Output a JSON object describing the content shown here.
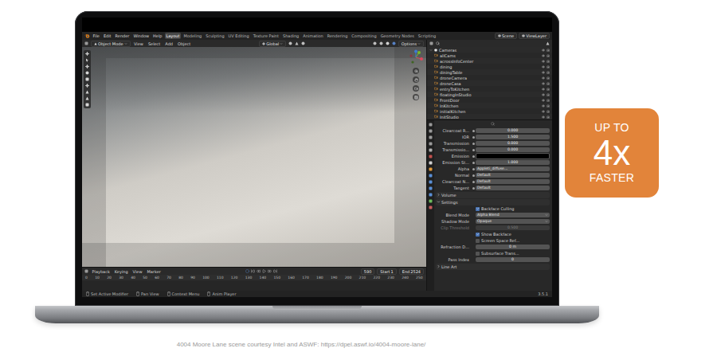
{
  "blender": {
    "menu": [
      "File",
      "Edit",
      "Render",
      "Window",
      "Help"
    ],
    "workspaces": [
      {
        "label": "Layout",
        "selected": true
      },
      {
        "label": "Modeling",
        "selected": false
      },
      {
        "label": "Sculpting",
        "selected": false
      },
      {
        "label": "UV Editing",
        "selected": false
      },
      {
        "label": "Texture Paint",
        "selected": false
      },
      {
        "label": "Shading",
        "selected": false
      },
      {
        "label": "Animation",
        "selected": false
      },
      {
        "label": "Rendering",
        "selected": false
      },
      {
        "label": "Compositing",
        "selected": false
      },
      {
        "label": "Geometry Nodes",
        "selected": false
      },
      {
        "label": "Scripting",
        "selected": false
      }
    ],
    "scene": "Scene",
    "view_layer": "ViewLayer",
    "viewport": {
      "mode": "Object Mode",
      "menus": [
        "View",
        "Select",
        "Add",
        "Object"
      ],
      "orientation": "Global",
      "options": "Options"
    },
    "outliner": {
      "items": [
        {
          "label": "Cameras",
          "kind": "collection",
          "selected": false
        },
        {
          "label": "allCams",
          "kind": "camera",
          "selected": false
        },
        {
          "label": "acrossInfoCenter",
          "kind": "camera",
          "selected": false
        },
        {
          "label": "dining",
          "kind": "camera",
          "selected": false
        },
        {
          "label": "diningTable",
          "kind": "camera",
          "selected": false
        },
        {
          "label": "droneCamera",
          "kind": "camera",
          "selected": false
        },
        {
          "label": "droneCasa",
          "kind": "camera",
          "selected": false
        },
        {
          "label": "entryToKitchen",
          "kind": "camera",
          "selected": false
        },
        {
          "label": "floatingInStudio",
          "kind": "camera",
          "selected": false
        },
        {
          "label": "FrontDoor",
          "kind": "camera",
          "selected": false
        },
        {
          "label": "InKitchen",
          "kind": "camera",
          "selected": false
        },
        {
          "label": "initialKitchen",
          "kind": "camera",
          "selected": false
        },
        {
          "label": "InitStudio",
          "kind": "camera",
          "selected": false
        }
      ]
    },
    "properties": {
      "rows": [
        {
          "kind": "number",
          "label": "Clearcoat R...",
          "value": "0.000"
        },
        {
          "kind": "number",
          "label": "IOR",
          "value": "1.500"
        },
        {
          "kind": "number",
          "label": "Transmission",
          "value": "0.000"
        },
        {
          "kind": "number",
          "label": "Transmissio...",
          "value": "0.000"
        },
        {
          "kind": "color",
          "label": "Emission",
          "color": "#000000"
        },
        {
          "kind": "number",
          "label": "Emission St...",
          "value": "1.000"
        },
        {
          "kind": "link",
          "label": "Alpha",
          "value": "Appleti_diffuse..."
        },
        {
          "kind": "link",
          "label": "Normal",
          "value": "Default"
        },
        {
          "kind": "link",
          "label": "Clearcoat N...",
          "value": "Default"
        },
        {
          "kind": "link",
          "label": "Tangent",
          "value": "Default"
        },
        {
          "kind": "section",
          "label": "Volume",
          "expanded": false
        },
        {
          "kind": "section",
          "label": "Settings",
          "expanded": true
        },
        {
          "kind": "checkbox",
          "label": "Backface Culling",
          "checked": true
        },
        {
          "kind": "dropdown",
          "label": "Blend Mode",
          "value": "Alpha Blend"
        },
        {
          "kind": "dropdown",
          "label": "Shadow Mode",
          "value": "Opaque"
        },
        {
          "kind": "field",
          "label": "Clip Threshold",
          "value": "0.500",
          "disabled": true
        },
        {
          "kind": "checkbox",
          "label": "Show Backface",
          "checked": true
        },
        {
          "kind": "checkbox",
          "label": "Screen Space Ref...",
          "checked": false
        },
        {
          "kind": "field",
          "label": "Refraction D...",
          "value": "0 m",
          "disabled": false
        },
        {
          "kind": "checkbox",
          "label": "Subsurface Trans...",
          "checked": false
        },
        {
          "kind": "field",
          "label": "Pass Index",
          "value": "0",
          "disabled": false
        },
        {
          "kind": "section",
          "label": "Line Art",
          "expanded": false
        }
      ]
    },
    "timeline": {
      "menus": [
        "Playback",
        "Keying",
        "View",
        "Marker"
      ],
      "frame": "590",
      "start_label": "Start",
      "start": "1",
      "end_label": "End",
      "end": "2524",
      "ruler": [
        "0",
        "10",
        "20",
        "30",
        "40",
        "50",
        "60",
        "70",
        "80",
        "90",
        "100",
        "110",
        "120",
        "130",
        "140",
        "150",
        "160",
        "170",
        "180",
        "190",
        "200",
        "210",
        "220",
        "230",
        "240",
        "250"
      ]
    },
    "status_bar": {
      "items": [
        "Set Active Modifier",
        "Pan View",
        "Context Menu",
        "Anim Player"
      ],
      "version": "3.5.1"
    }
  },
  "badge": {
    "top": "UP TO",
    "figure": "4x",
    "bottom": "FASTER"
  },
  "caption": "4004 Moore Lane scene courtesy Intel and ASWF: https://dpel.aswf.io/4004-moore-lane/"
}
